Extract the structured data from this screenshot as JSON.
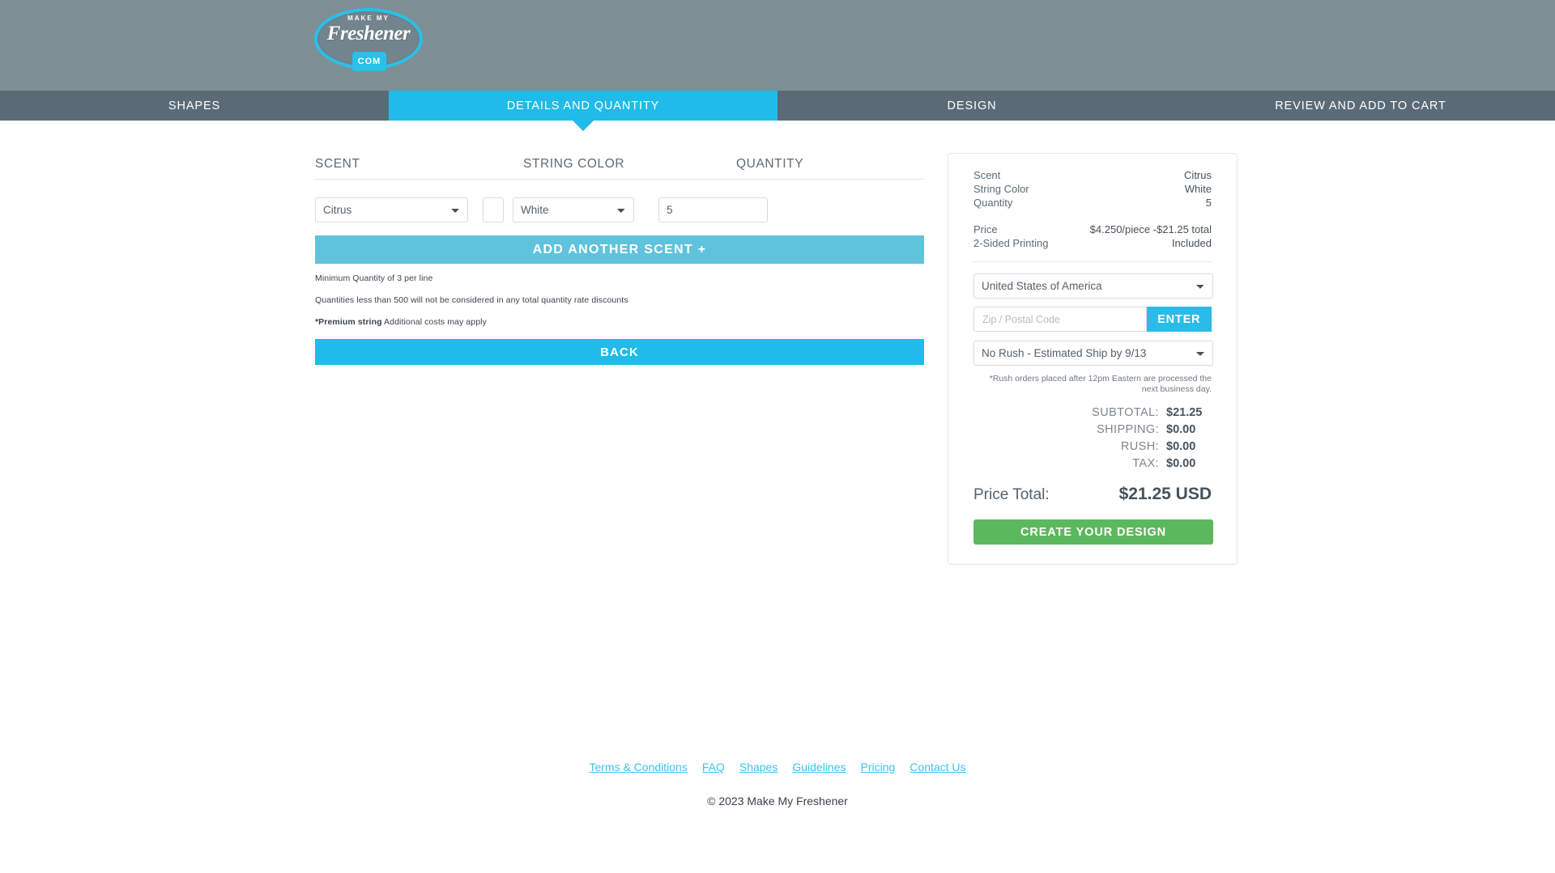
{
  "brand": {
    "logo_line1": "MAKE MY",
    "logo_line2": "Freshener",
    "logo_badge": "COM"
  },
  "nav": {
    "tabs": [
      {
        "label": "SHAPES",
        "active": false
      },
      {
        "label": "DETAILS AND QUANTITY",
        "active": true
      },
      {
        "label": "DESIGN",
        "active": false
      },
      {
        "label": "REVIEW AND ADD TO CART",
        "active": false
      }
    ],
    "active_color": "#20bbe8",
    "bar_color": "#5a6b77"
  },
  "form": {
    "headers": {
      "scent": "SCENT",
      "string_color": "STRING COLOR",
      "quantity": "QUANTITY"
    },
    "scent_value": "Citrus",
    "swatch_color": "#ffffff",
    "string_color_value": "White",
    "quantity_value": "5",
    "add_scent_label": "ADD ANOTHER SCENT +",
    "back_label": "BACK",
    "notes": {
      "min_qty": "Minimum Quantity of 3 per line",
      "discount": "Quantities less than 500 will not be considered in any total quantity rate discounts",
      "premium_bold": "*Premium string",
      "premium_rest": " Additional costs may apply"
    }
  },
  "summary": {
    "rows": [
      {
        "label": "Scent",
        "value": "Citrus"
      },
      {
        "label": "String Color",
        "value": "White"
      },
      {
        "label": "Quantity",
        "value": "5"
      }
    ],
    "price_rows": [
      {
        "label": "Price",
        "value": "$4.250/piece -$21.25 total"
      },
      {
        "label": "2-Sided Printing",
        "value": "Included"
      }
    ],
    "country_value": "United States of America",
    "zip_placeholder": "Zip / Postal Code",
    "zip_value": "",
    "enter_label": "ENTER",
    "rush_value": "No Rush - Estimated Ship by 9/13",
    "rush_note": "*Rush orders placed after 12pm Eastern are processed the next business day.",
    "totals": [
      {
        "label": "SUBTOTAL:",
        "value": "$21.25"
      },
      {
        "label": "SHIPPING:",
        "value": "$0.00"
      },
      {
        "label": "RUSH:",
        "value": "$0.00"
      },
      {
        "label": "TAX:",
        "value": "$0.00"
      }
    ],
    "grand_label": "Price Total:",
    "grand_value": "$21.25 USD",
    "create_design_label": "CREATE YOUR DESIGN",
    "create_design_color": "#5cb85c"
  },
  "footer": {
    "links": [
      "Terms & Conditions",
      "FAQ",
      "Shapes",
      "Guidelines",
      "Pricing",
      "Contact Us"
    ],
    "copyright": "© 2023 Make My Freshener",
    "link_color": "#3cc3ef"
  }
}
